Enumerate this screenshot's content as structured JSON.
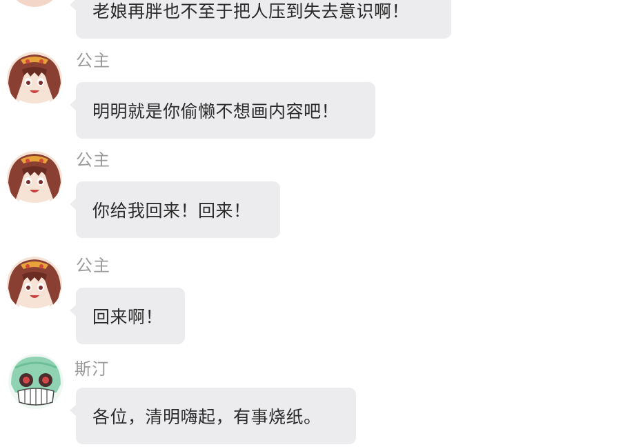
{
  "messages": [
    {
      "sender": "",
      "avatar": "princess-avatar",
      "text": "老娘再胖也不至于把人压到失去意识啊！"
    },
    {
      "sender": "公主",
      "avatar": "princess-avatar",
      "text": "明明就是你偷懒不想画内容吧！"
    },
    {
      "sender": "公主",
      "avatar": "princess-avatar",
      "text": "你给我回来！回来！"
    },
    {
      "sender": "公主",
      "avatar": "princess-avatar",
      "text": "回来啊！"
    },
    {
      "sender": "斯汀",
      "avatar": "sting-avatar",
      "text": "各位，清明嗨起，有事烧纸。"
    }
  ],
  "colors": {
    "bubble": "#ececee",
    "sender_name": "#9a9a9a",
    "message_text": "#2a2a2a"
  }
}
